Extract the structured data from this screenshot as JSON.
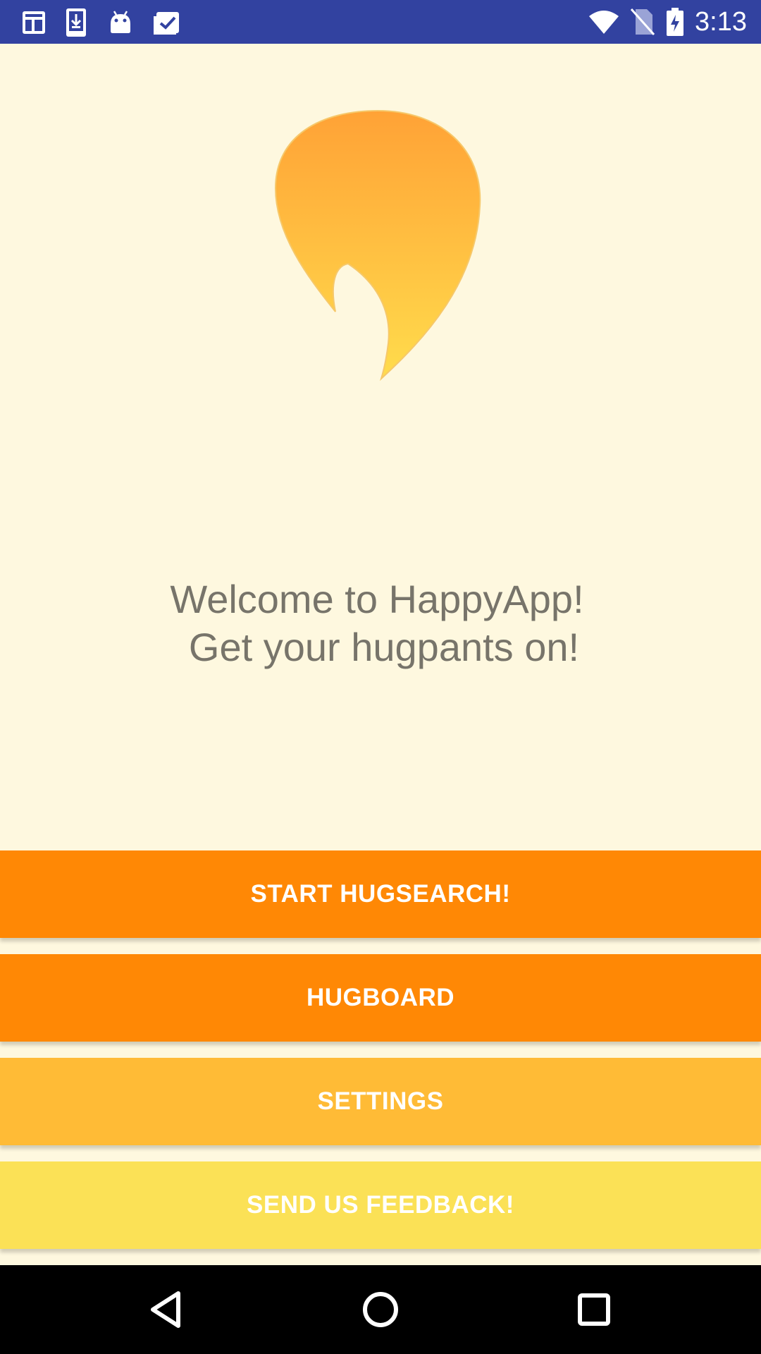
{
  "status_bar": {
    "clock": "3:13",
    "left_icons": [
      "calendar-icon",
      "download-icon",
      "android-icon",
      "clipboard-check-icon"
    ],
    "right_icons": [
      "wifi-icon",
      "no-sim-icon",
      "battery-charging-icon"
    ],
    "background": "#3242A0"
  },
  "welcome": {
    "line1": "Welcome to HappyApp!",
    "line2": "Get your hugpants on!"
  },
  "buttons": {
    "start_hugsearch": "START HUGSEARCH!",
    "hugboard": "HUGBOARD",
    "settings": "SETTINGS",
    "send_feedback": "SEND US FEEDBACK!"
  },
  "colors": {
    "background": "#FEF8DF",
    "primary_orange": "#FF8805",
    "light_orange": "#FFBB36",
    "yellow": "#FBE156",
    "text_gray": "#77746A"
  },
  "nav_bar": {
    "buttons": [
      "back-icon",
      "home-icon",
      "recents-icon"
    ]
  }
}
